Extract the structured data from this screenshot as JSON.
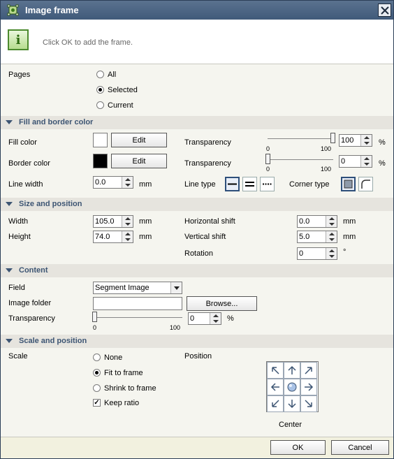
{
  "window": {
    "title": "Image frame"
  },
  "info": {
    "message": "Click OK to add the frame."
  },
  "pages": {
    "label": "Pages",
    "options": [
      "All",
      "Selected",
      "Current"
    ],
    "selected": "Selected"
  },
  "fill_border": {
    "section_title": "Fill and border color",
    "fill_label": "Fill color",
    "fill_color": "#ffffff",
    "fill_edit": "Edit",
    "fill_transparency_label": "Transparency",
    "fill_transparency": "100",
    "fill_slider": {
      "min": "0",
      "max": "100",
      "value": 100
    },
    "border_label": "Border color",
    "border_color": "#000000",
    "border_edit": "Edit",
    "border_transparency_label": "Transparency",
    "border_transparency": "0",
    "border_slider": {
      "min": "0",
      "max": "100",
      "value": 0
    },
    "percent": "%",
    "line_width_label": "Line width",
    "line_width": "0.0",
    "line_width_unit": "mm",
    "line_type_label": "Line type",
    "corner_type_label": "Corner type"
  },
  "size_position": {
    "section_title": "Size and position",
    "width_label": "Width",
    "width": "105.0",
    "height_label": "Height",
    "height": "74.0",
    "unit": "mm",
    "hshift_label": "Horizontal shift",
    "hshift": "0.0",
    "vshift_label": "Vertical shift",
    "vshift": "5.0",
    "rotation_label": "Rotation",
    "rotation": "0",
    "degree": "°"
  },
  "content": {
    "section_title": "Content",
    "field_label": "Field",
    "field_value": "Segment Image",
    "folder_label": "Image folder",
    "folder_value": "",
    "browse": "Browse...",
    "transparency_label": "Transparency",
    "transparency": "0",
    "slider": {
      "min": "0",
      "max": "100",
      "value": 0
    },
    "percent": "%"
  },
  "scale_position": {
    "section_title": "Scale and position",
    "scale_label": "Scale",
    "options": [
      "None",
      "Fit to frame",
      "Shrink to frame"
    ],
    "selected": "Fit to frame",
    "keep_ratio_label": "Keep ratio",
    "keep_ratio": true,
    "position_label": "Position",
    "position_value": "Center"
  },
  "footer": {
    "ok": "OK",
    "cancel": "Cancel"
  },
  "colors": {
    "title_bar": "#4a6383",
    "section_text": "#3d5573",
    "section_bg": "#e6e4de"
  }
}
